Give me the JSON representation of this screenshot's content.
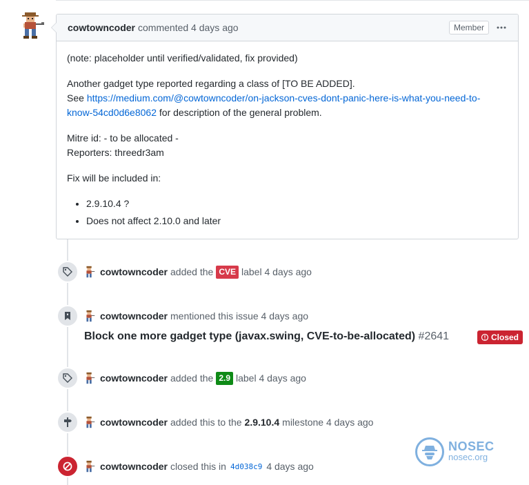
{
  "comment": {
    "author": "cowtowncoder",
    "meta": "commented 4 days ago",
    "role_badge": "Member",
    "body": {
      "p1": "(note: placeholder until verified/validated, fix provided)",
      "p2_line1": "Another gadget type reported regarding a class of [TO BE ADDED].",
      "p2_see": "See ",
      "p2_link": "https://medium.com/@cowtowncoder/on-jackson-cves-dont-panic-here-is-what-you-need-to-know-54cd0d6e8062",
      "p2_link_line1": "https://medium.com/@cowtowncoder/on-jackson-cves-dont-panic-here-is-what-you-need-to-",
      "p2_link_line2": "know-54cd0d6e8062",
      "p2_after": " for description of the general problem.",
      "p3_line1": "Mitre id: - to be allocated -",
      "p3_line2": "Reporters: threedr3am",
      "p4": "Fix will be included in:",
      "list": [
        "2.9.10.4 ?",
        "Does not affect 2.10.0 and later"
      ]
    }
  },
  "timeline": {
    "label_cve": {
      "actor": "cowtowncoder",
      "pre": "added the",
      "label": "CVE",
      "label_color": "#d73a4a",
      "post": "label 4 days ago"
    },
    "mention": {
      "actor": "cowtowncoder",
      "text": "mentioned this issue 4 days ago",
      "ref_title": "Block one more gadget type (javax.swing, CVE-to-be-allocated)",
      "ref_number": "#2641",
      "ref_state": "Closed",
      "state_color": "#cb2431"
    },
    "label_29": {
      "actor": "cowtowncoder",
      "pre": "added the",
      "label": "2.9",
      "label_color": "#0e8a16",
      "post": "label 4 days ago"
    },
    "milestone": {
      "actor": "cowtowncoder",
      "pre": "added this to the",
      "milestone": "2.9.10.4",
      "post": "milestone 4 days ago"
    },
    "closed": {
      "actor": "cowtowncoder",
      "pre": "closed this in",
      "commit": "4d038c9",
      "post": "4 days ago"
    }
  },
  "watermark": {
    "brand": "NOSEC",
    "domain": "nosec.org"
  },
  "icons": {
    "avatar": "pixel-cowboy-avatar",
    "tag": "tag-icon",
    "bookmark": "bookmark-icon",
    "milestone": "milestone-icon",
    "closed": "circle-slash-icon",
    "kebab": "kebab-horizontal-icon"
  }
}
